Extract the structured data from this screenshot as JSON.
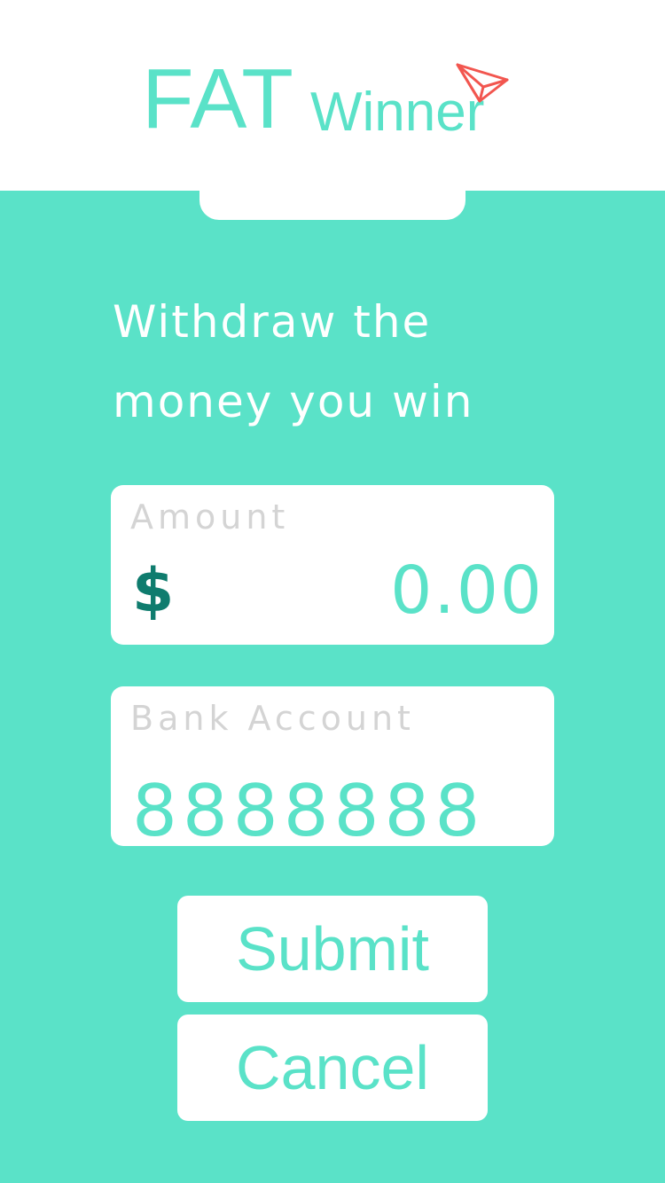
{
  "header": {
    "logo_primary": "FAT",
    "logo_secondary": "Winner",
    "icon": "paper-plane-icon",
    "icon_color": "#f2564f"
  },
  "main": {
    "headline_line1": "Withdraw the",
    "headline_line2": "money you win",
    "amount": {
      "label": "Amount",
      "currency_symbol": "$",
      "value": "0.00"
    },
    "bank": {
      "label": "Bank Account",
      "value": "8888888"
    },
    "buttons": {
      "submit_label": "Submit",
      "cancel_label": "Cancel"
    }
  },
  "colors": {
    "accent": "#5ae2c8",
    "background": "#5ae2c8",
    "currency": "#0f7c6e",
    "label": "#d4d4d4",
    "surface": "#ffffff"
  }
}
